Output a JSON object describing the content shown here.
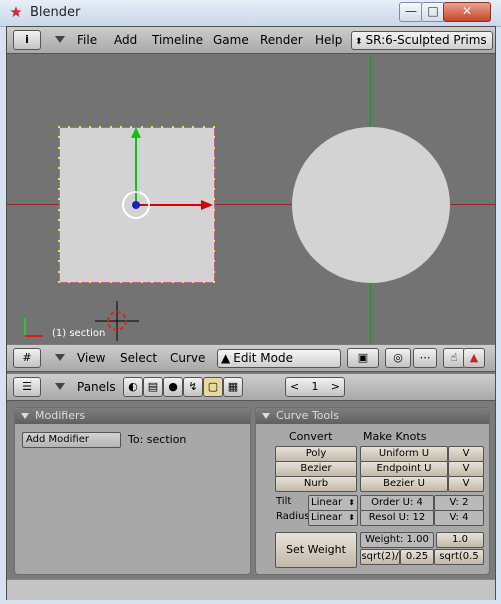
{
  "window": {
    "title": "Blender",
    "controls": {
      "minimize": "—",
      "maximize": "□",
      "close": "✕"
    }
  },
  "top_header": {
    "menus": [
      "File",
      "Add",
      "Timeline",
      "Game",
      "Render",
      "Help"
    ],
    "screen_selector": "SR:6-Sculpted Prims"
  },
  "viewport": {
    "object_label": "(1) section"
  },
  "view3d_header": {
    "menus": [
      "View",
      "Select",
      "Curve"
    ],
    "mode": "Edit Mode"
  },
  "buttons_header": {
    "panels_label": "Panels",
    "frame": "1",
    "prev_arrow": "<",
    "next_arrow": ">"
  },
  "modifiers_panel": {
    "title": "Modifiers",
    "add_modifier": "Add Modifier",
    "to_label": "To: section"
  },
  "curve_tools_panel": {
    "title": "Curve Tools",
    "convert_label": "Convert",
    "make_knots_label": "Make Knots",
    "convert_buttons": [
      "Poly",
      "Bezier",
      "Nurb"
    ],
    "knot_buttons": [
      "Uniform U",
      "Endpoint U",
      "Bezier U"
    ],
    "v_buttons": [
      "V",
      "V",
      "V"
    ],
    "tilt_label": "Tilt",
    "tilt_value": "Linear",
    "radius_label": "Radius",
    "radius_value": "Linear",
    "order_u": "Order U: 4",
    "order_v": "V: 2",
    "resol_u": "Resol U: 12",
    "resol_v": "V: 4",
    "set_weight": "Set Weight",
    "weight": "Weight: 1.00",
    "weight_presets": [
      "1.0",
      "sqrt(2)/",
      "0.25",
      "sqrt(0.5"
    ]
  }
}
